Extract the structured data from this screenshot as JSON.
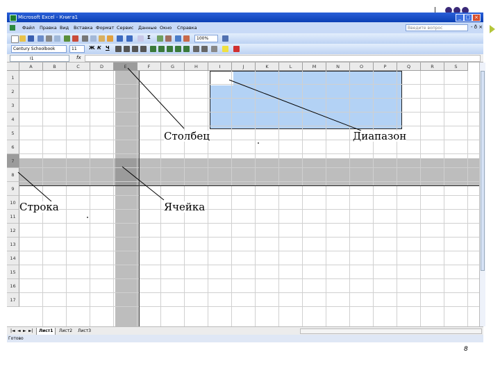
{
  "window": {
    "title": "Microsoft Excel - Книга1",
    "buttons": [
      "_",
      "□",
      "×"
    ]
  },
  "menu": {
    "items": [
      "Файл",
      "Правка",
      "Вид",
      "Вставка",
      "Формат",
      "Сервис",
      "Данные",
      "Окно",
      "Справка"
    ],
    "help_placeholder": "Введите вопрос",
    "doc_controls": "- ð ×"
  },
  "toolbar": {
    "zoom": "100%",
    "font_name": "Century Schoolbook",
    "font_size": "11",
    "bold": "Ж",
    "italic": "К",
    "underline": "Ч"
  },
  "formula_bar": {
    "name_box": "I1",
    "fx": "fx",
    "value": ""
  },
  "grid": {
    "columns": [
      "A",
      "B",
      "C",
      "D",
      "E",
      "F",
      "G",
      "H",
      "I",
      "J",
      "K",
      "L",
      "M",
      "N",
      "O",
      "P",
      "Q",
      "R",
      "S"
    ],
    "rows": [
      "1",
      "2",
      "3",
      "4",
      "5",
      "6",
      "7",
      "8",
      "9",
      "10",
      "11",
      "12",
      "13",
      "14",
      "15",
      "16",
      "17"
    ],
    "selected_column": "E",
    "selected_row": "7",
    "selected_range": "I1:P4"
  },
  "sheets": {
    "tabs": [
      "Лист1",
      "Лист2",
      "Лист3"
    ],
    "nav": [
      "|◄",
      "◄",
      "►",
      "►|"
    ]
  },
  "status": {
    "text": "Готово"
  },
  "annotations": {
    "column": "Столбец",
    "range": "Диапазон",
    "row": "Строка",
    "cell": "Ячейка"
  },
  "slide": {
    "page_number": "8"
  },
  "colors": {
    "titlebar": "#0a3fb4",
    "range_fill": "#b3d2f5",
    "selection_shade": "#bdbdbd",
    "cell_shade": "#9b9b9b",
    "bullet": "#b5c63b",
    "dots": "#3a2a78"
  }
}
